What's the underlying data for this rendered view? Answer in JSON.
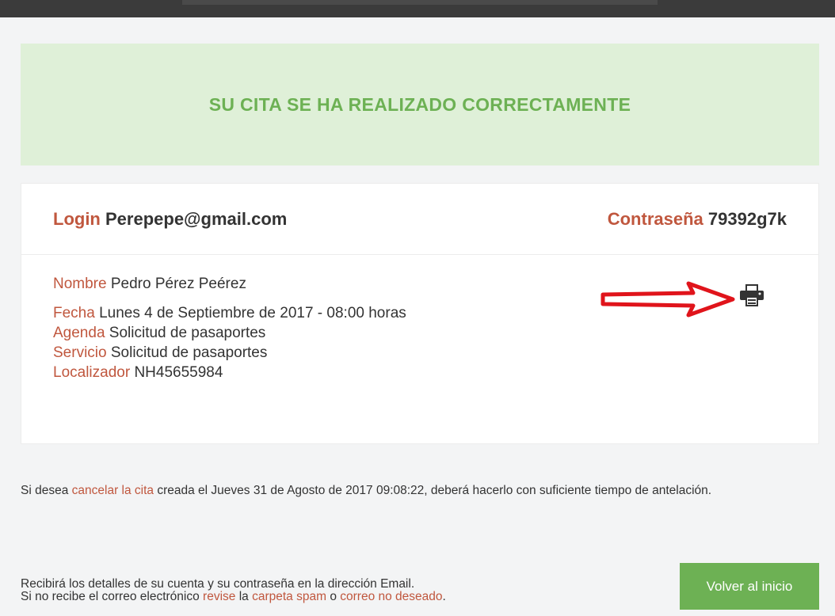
{
  "success": {
    "title": "SU CITA SE HA REALIZADO CORRECTAMENTE"
  },
  "account": {
    "login_label": "Login",
    "login_value": "Perepepe@gmail.com",
    "password_label": "Contraseña",
    "password_value": "79392g7k"
  },
  "appointment": {
    "name_label": "Nombre",
    "name_value": "Pedro Pérez Peérez",
    "date_label": "Fecha",
    "date_value": "Lunes 4 de Septiembre de 2017 - 08:00 horas",
    "agenda_label": "Agenda",
    "agenda_value": "Solicitud de pasaportes",
    "service_label": "Servicio",
    "service_value": "Solicitud de pasaportes",
    "locator_label": "Localizador",
    "locator_value": "NH45655984"
  },
  "print": {
    "icon": "print-icon",
    "annotation_arrow_color": "#e0141b"
  },
  "cancel_note": {
    "prefix": "Si desea ",
    "link": "cancelar la cita",
    "suffix": " creada el Jueves 31 de Agosto de 2017 09:08:22, deberá hacerlo con suficiente tiempo de antelación."
  },
  "email_note": {
    "line1": "Recibirá los detalles de su cuenta y su contraseña en la dirección Email.",
    "line2_prefix": "Si no recibe el correo electrónico ",
    "line2_link1": "revise",
    "line2_mid1": " la ",
    "line2_link2": "carpeta spam",
    "line2_mid2": " o ",
    "line2_link3": "correo no deseado",
    "line2_end": "."
  },
  "buttons": {
    "home": "Volver al inicio"
  },
  "colors": {
    "accent_green": "#6db154",
    "success_bg": "#dff0d8",
    "label_red": "#c0573e"
  }
}
